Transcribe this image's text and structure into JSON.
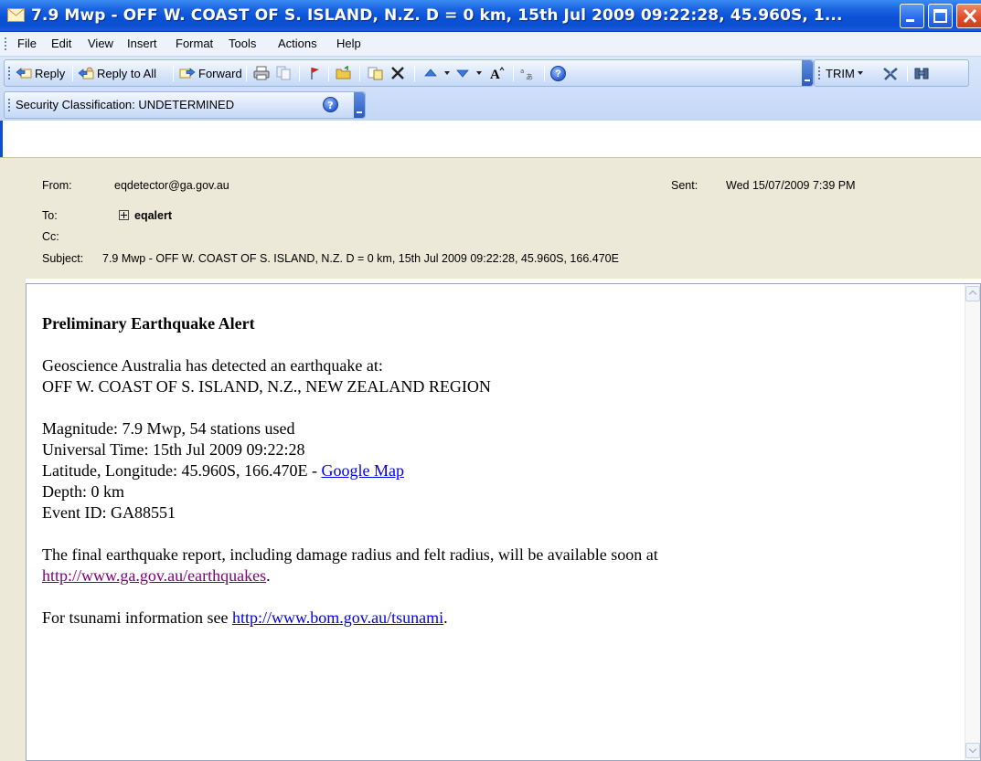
{
  "window": {
    "title": "7.9 Mwp - OFF W. COAST OF S. ISLAND, N.Z. D = 0 km, 15th Jul 2009 09:22:28, 45.960S, 1..."
  },
  "menu": {
    "items": [
      "File",
      "Edit",
      "View",
      "Insert",
      "Format",
      "Tools",
      "Actions",
      "Help"
    ]
  },
  "toolbar": {
    "reply": "Reply",
    "reply_all": "Reply to All",
    "forward": "Forward",
    "trim": "TRIM"
  },
  "security": {
    "label": "Security Classification: UNDETERMINED"
  },
  "header": {
    "from_label": "From:",
    "from_value": "eqdetector@ga.gov.au",
    "sent_label": "Sent:",
    "sent_value": "Wed 15/07/2009 7:39 PM",
    "to_label": "To:",
    "to_value": "eqalert",
    "cc_label": "Cc:",
    "subject_label": "Subject:",
    "subject_value": "7.9 Mwp - OFF W. COAST OF S. ISLAND, N.Z. D = 0 km, 15th Jul 2009 09:22:28, 45.960S, 166.470E"
  },
  "message": {
    "heading": "Preliminary Earthquake Alert",
    "detected_line": "Geoscience Australia has detected an earthquake at:",
    "location_line": "OFF W. COAST OF S. ISLAND, N.Z., NEW ZEALAND REGION",
    "magnitude": "Magnitude: 7.9 Mwp, 54 stations used",
    "time": "Universal Time: 15th Jul 2009 09:22:28",
    "latlon_prefix": "Latitude, Longitude: 45.960S, 166.470E - ",
    "map_link": "Google Map",
    "depth": "Depth: 0 km",
    "event_id": "Event ID: GA88551",
    "final_report": "The final earthquake report, including damage radius and felt radius, will be available soon at",
    "ga_link": "http://www.ga.gov.au/earthquakes",
    "ga_link_suffix": ".",
    "tsunami_prefix": "For tsunami information see ",
    "bom_link": "http://www.bom.gov.au/tsunami",
    "bom_link_suffix": "."
  },
  "colors": {
    "titlebar": "#0a52d8",
    "header_bg": "#ece9d8",
    "link": "#0000ee",
    "visited_link": "#800080"
  }
}
